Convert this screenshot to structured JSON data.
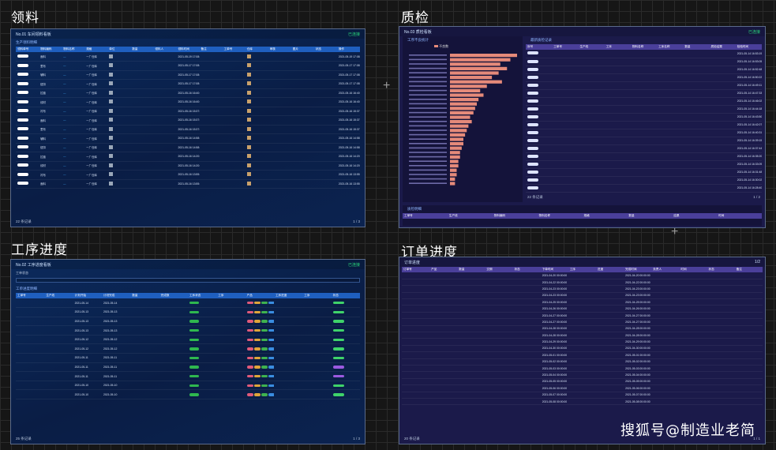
{
  "quadrants": {
    "tl_label": "领料",
    "tr_label": "质检",
    "bl_label": "工序进度",
    "br_label": "订单进度"
  },
  "watermark": "搜狐号@制造业老简",
  "material": {
    "header": "No.01 车间领料看板",
    "status": "已连接",
    "section": "生产领料明细",
    "columns": [
      "领料单号",
      "物料编码",
      "物料名称",
      "规格",
      "单位",
      "数量",
      "领料人",
      "领料时间",
      "备注",
      "工单号",
      "仓库",
      "审核",
      "图片",
      "状态",
      "操作"
    ],
    "rows": [
      {
        "a": "面料",
        "b": "一厂仓库",
        "t": "2021-05-19 17:08:08"
      },
      {
        "a": "里布",
        "b": "一厂仓库",
        "t": "2021-05-17 17:08:01"
      },
      {
        "a": "辅料",
        "b": "一厂仓库",
        "t": "2021-05-17 17:08:01"
      },
      {
        "a": "纽扣",
        "b": "一厂仓库",
        "t": "2021-05-17 17:08:01"
      },
      {
        "a": "拉链",
        "b": "一厂仓库",
        "t": "2021-05-16 16:40:40"
      },
      {
        "a": "线材",
        "b": "一厂仓库",
        "t": "2021-05-16 16:40:40"
      },
      {
        "a": "衬布",
        "b": "一厂仓库",
        "t": "2021-05-16 15:37:02"
      },
      {
        "a": "面料",
        "b": "一厂仓库",
        "t": "2021-05-16 15:37:02"
      },
      {
        "a": "里布",
        "b": "一厂仓库",
        "t": "2021-05-16 15:37:02"
      },
      {
        "a": "辅料",
        "b": "一厂仓库",
        "t": "2021-05-16 14:58:22"
      },
      {
        "a": "纽扣",
        "b": "一厂仓库",
        "t": "2021-05-16 14:58:22"
      },
      {
        "a": "拉链",
        "b": "一厂仓库",
        "t": "2021-05-16 14:20:11"
      },
      {
        "a": "线材",
        "b": "一厂仓库",
        "t": "2021-05-16 14:20:11"
      },
      {
        "a": "衬布",
        "b": "一厂仓库",
        "t": "2021-05-16 13:55:40"
      },
      {
        "a": "面料",
        "b": "一厂仓库",
        "t": "2021-05-16 13:55:40"
      }
    ],
    "total": "22 条记录",
    "page": "1 / 3"
  },
  "quality": {
    "header": "No.03 质检看板",
    "status": "已连接",
    "chart_title": "工序不良统计",
    "legend": "不良数",
    "table_title": "最新质检记录",
    "columns": [
      "序号",
      "工单号",
      "生产线",
      "工序",
      "物料名称",
      "工序名称",
      "数量",
      "质检结果",
      "检验时间"
    ],
    "bottom_title": "质检明细",
    "bottom_cols": [
      "工单号",
      "生产线",
      "物料编码",
      "物料名称",
      "规格",
      "数量",
      "结果",
      "时间"
    ],
    "total": "22 条记录",
    "page": "1 / 2",
    "chart_data": {
      "type": "bar",
      "orientation": "horizontal",
      "values": [
        40,
        36,
        30,
        34,
        29,
        25,
        31,
        22,
        18,
        20,
        17,
        16,
        15,
        14,
        12,
        13,
        11,
        10,
        9,
        8,
        8,
        7,
        6,
        6,
        5,
        5,
        4,
        4,
        3,
        3
      ]
    },
    "rows": [
      {
        "n": "2021-05-14 16:53:19"
      },
      {
        "n": "2021-05-14 16:53:05"
      },
      {
        "n": "2021-05-14 16:52:48"
      },
      {
        "n": "2021-05-14 16:50:22"
      },
      {
        "n": "2021-05-14 16:49:11"
      },
      {
        "n": "2021-05-14 16:47:33"
      },
      {
        "n": "2021-05-14 16:46:02"
      },
      {
        "n": "2021-05-14 16:44:18"
      },
      {
        "n": "2021-05-14 16:43:50"
      },
      {
        "n": "2021-05-14 16:42:07"
      },
      {
        "n": "2021-05-14 16:40:31"
      },
      {
        "n": "2021-05-14 16:39:15"
      },
      {
        "n": "2021-05-14 16:37:44"
      },
      {
        "n": "2021-05-14 16:35:20"
      },
      {
        "n": "2021-05-14 16:33:09"
      },
      {
        "n": "2021-05-14 16:31:48"
      },
      {
        "n": "2021-05-14 16:30:02"
      },
      {
        "n": "2021-05-14 16:28:40"
      }
    ]
  },
  "process": {
    "header": "No.02 工序进度看板",
    "status": "已连接",
    "filter_label": "工单状态",
    "section": "工单进度明细",
    "columns": [
      "工单号",
      "生产线",
      "计划开始",
      "计划完成",
      "数量",
      "完成数",
      "工序状态",
      "工序",
      "产品",
      "工序进度",
      "工序",
      "状态"
    ],
    "total": "25 条记录",
    "page": "1 / 3",
    "rows": [
      {
        "d": "2021-05-14",
        "s": "green"
      },
      {
        "d": "2021-05-13",
        "s": "green"
      },
      {
        "d": "2021-05-13",
        "s": "green"
      },
      {
        "d": "2021-05-13",
        "s": "green"
      },
      {
        "d": "2021-05-12",
        "s": "green"
      },
      {
        "d": "2021-05-12",
        "s": "green"
      },
      {
        "d": "2021-05-11",
        "s": "green"
      },
      {
        "d": "2021-05-11",
        "s": "purple"
      },
      {
        "d": "2021-05-11",
        "s": "purple"
      },
      {
        "d": "2021-05-10",
        "s": "green"
      },
      {
        "d": "2021-05-10",
        "s": "green"
      }
    ]
  },
  "order": {
    "header": "订单进度",
    "status": "1/2",
    "columns": [
      "订单号",
      "产品",
      "数量",
      "交期",
      "状态",
      "下单时间",
      "工序",
      "进度",
      "完成时间",
      "负责人",
      "时间",
      "状态",
      "备注"
    ],
    "total": "20 条记录",
    "page": "1 / 1",
    "rows": [
      {
        "t": "2021-04-20 00:00:00"
      },
      {
        "t": "2021-04-22 00:00:00"
      },
      {
        "t": "2021-04-23 00:00:00"
      },
      {
        "t": "2021-04-23 00:00:00"
      },
      {
        "t": "2021-04-25 00:00:00"
      },
      {
        "t": "2021-04-26 00:00:00"
      },
      {
        "t": "2021-04-27 00:00:00"
      },
      {
        "t": "2021-04-27 00:00:00"
      },
      {
        "t": "2021-04-28 00:00:00"
      },
      {
        "t": "2021-04-28 00:00:00"
      },
      {
        "t": "2021-04-29 00:00:00"
      },
      {
        "t": "2021-04-30 00:00:00"
      },
      {
        "t": "2021-05-01 00:00:00"
      },
      {
        "t": "2021-05-02 00:00:00"
      },
      {
        "t": "2021-05-03 00:00:00"
      },
      {
        "t": "2021-05-04 00:00:00"
      },
      {
        "t": "2021-05-05 00:00:00"
      },
      {
        "t": "2021-05-06 00:00:00"
      },
      {
        "t": "2021-05-07 00:00:00"
      },
      {
        "t": "2021-05-08 00:00:00"
      }
    ]
  }
}
